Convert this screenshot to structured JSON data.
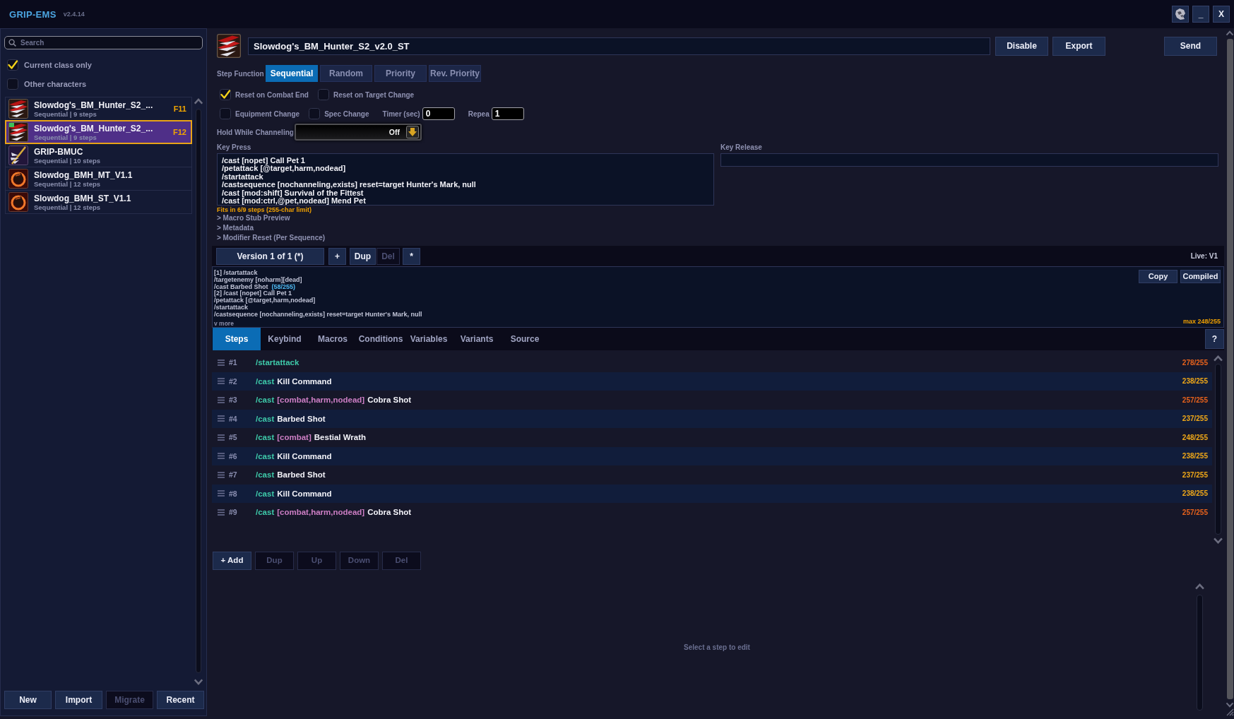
{
  "window": {
    "title": "GRIP-EMS",
    "version": "v2.4.14",
    "buttons": [
      "_",
      "X"
    ]
  },
  "sidebar": {
    "search": {
      "placeholder": "Search"
    },
    "filters": [
      {
        "label": "Current class only",
        "checked": true
      },
      {
        "label": "Other characters",
        "checked": false
      }
    ],
    "sequences": [
      {
        "kind": "claw",
        "title": "Slowdog's_BM_Hunter_S2_...",
        "subtitle": "Sequential | 9 steps",
        "keybind": "F11",
        "selected": false,
        "marked": false
      },
      {
        "kind": "claw",
        "title": "Slowdog's_BM_Hunter_S2_...",
        "subtitle": "Sequential | 9 steps",
        "keybind": "F12",
        "selected": true,
        "marked": true
      },
      {
        "kind": "spear",
        "title": "GRIP-BMUC",
        "subtitle": "Sequential | 10 steps",
        "selected": false,
        "marked": false
      },
      {
        "kind": "flame",
        "title": "Slowdog_BMH_MT_V1.1",
        "subtitle": "Sequential | 12 steps",
        "selected": false,
        "marked": false
      },
      {
        "kind": "flame",
        "title": "Slowdog_BMH_ST_V1.1",
        "subtitle": "Sequential | 12 steps",
        "selected": false,
        "marked": false
      }
    ],
    "buttons": [
      {
        "label": "New",
        "disabled": false
      },
      {
        "label": "Import",
        "disabled": false
      },
      {
        "label": "Migrate",
        "disabled": true
      },
      {
        "label": "Recent",
        "disabled": false
      }
    ]
  },
  "editor": {
    "name": "Slowdog's_BM_Hunter_S2_v2.0_ST",
    "header_buttons": [
      "Disable",
      "Export"
    ],
    "send_button": "Send",
    "step_function": {
      "label": "Step Function",
      "options": [
        {
          "label": "Sequential",
          "selected": true
        },
        {
          "label": "Random",
          "selected": false
        },
        {
          "label": "Priority",
          "selected": false
        },
        {
          "label": "Rev. Priority",
          "selected": false
        }
      ]
    },
    "option_rows": [
      [
        {
          "kind": "checkbox",
          "label": "Reset on Combat End",
          "checked": true
        },
        {
          "kind": "checkbox",
          "label": "Reset on Target Change",
          "checked": false
        }
      ],
      [
        {
          "kind": "checkbox",
          "label": "Equipment Change",
          "checked": false
        },
        {
          "kind": "checkbox",
          "label": "Spec Change",
          "checked": false
        },
        {
          "kind": "number",
          "label": "Timer (sec)",
          "value": "0"
        },
        {
          "kind": "number",
          "label": "Repea",
          "value": "1"
        }
      ]
    ],
    "hold_while_channeling": {
      "label": "Hold While Channeling",
      "value": "Off"
    },
    "key_press": {
      "label": "Key Press",
      "lines": [
        "/cast [nopet] Call Pet 1",
        "/petattack [@target,harm,nodead]",
        "/startattack",
        "/castsequence [nochanneling,exists] reset=target Hunter's Mark, null",
        "/cast [mod:shift] Survival of the Fittest",
        "/cast [mod:ctrl,@pet,nodead] Mend Pet"
      ]
    },
    "key_release": {
      "label": "Key Release"
    },
    "fit_note": "Fits in 6/9 steps (255-char limit)",
    "sections": [
      "> Macro Stub Preview",
      "> Metadata",
      "> Modifier Reset (Per Sequence)"
    ],
    "versions": {
      "current": "Version 1 of 1 (*)",
      "buttons": [
        {
          "label": "+",
          "disabled": false
        },
        {
          "label": "Dup",
          "disabled": false
        },
        {
          "label": "Del",
          "disabled": true
        },
        {
          "label": "*",
          "disabled": false
        }
      ],
      "live": "Live: V1"
    },
    "compiled": {
      "lines": [
        {
          "text": "[1] /startattack"
        },
        {
          "text": "/targetenemy [noharm][dead]"
        },
        {
          "text": "/cast Barbed Shot",
          "length": "(58/255)"
        },
        {
          "text": "[2] /cast [nopet] Call Pet 1"
        },
        {
          "text": "/petattack [@target,harm,nodead]"
        },
        {
          "text": "/startattack"
        },
        {
          "text": "/castsequence [nochanneling,exists] reset=target Hunter's Mark, null"
        }
      ],
      "more": "v more",
      "buttons": [
        "Copy",
        "Compiled"
      ],
      "max": "max 248/255"
    },
    "tabs": [
      {
        "label": "Steps",
        "selected": true
      },
      {
        "label": "Keybind",
        "selected": false
      },
      {
        "label": "Macros",
        "selected": false
      },
      {
        "label": "Conditions",
        "selected": false
      },
      {
        "label": "Variables",
        "selected": false
      },
      {
        "label": "Variants",
        "selected": false
      },
      {
        "label": "Source",
        "selected": false
      }
    ],
    "help": "?",
    "steps": [
      {
        "number": "#1",
        "command": "/startattack",
        "count": "278/255",
        "over_limit": true
      },
      {
        "number": "#2",
        "command": "/cast",
        "spell": "Kill Command",
        "count": "238/255",
        "over_limit": false
      },
      {
        "number": "#3",
        "command": "/cast",
        "conditions": "[combat,harm,nodead]",
        "spell": "Cobra Shot",
        "count": "257/255",
        "over_limit": true
      },
      {
        "number": "#4",
        "command": "/cast",
        "spell": "Barbed Shot",
        "count": "237/255",
        "over_limit": false
      },
      {
        "number": "#5",
        "command": "/cast",
        "conditions": "[combat]",
        "spell": "Bestial Wrath",
        "count": "248/255",
        "over_limit": false
      },
      {
        "number": "#6",
        "command": "/cast",
        "spell": "Kill Command",
        "count": "238/255",
        "over_limit": false
      },
      {
        "number": "#7",
        "command": "/cast",
        "spell": "Barbed Shot",
        "count": "237/255",
        "over_limit": false
      },
      {
        "number": "#8",
        "command": "/cast",
        "spell": "Kill Command",
        "count": "238/255",
        "over_limit": false
      },
      {
        "number": "#9",
        "command": "/cast",
        "conditions": "[combat,harm,nodead]",
        "spell": "Cobra Shot",
        "count": "257/255",
        "over_limit": true
      }
    ],
    "step_buttons": [
      {
        "label": "+ Add",
        "disabled": false
      },
      {
        "label": "Dup",
        "disabled": true
      },
      {
        "label": "Up",
        "disabled": true
      },
      {
        "label": "Down",
        "disabled": true
      },
      {
        "label": "Del",
        "disabled": true
      }
    ],
    "empty_message": "Select a step to edit"
  }
}
